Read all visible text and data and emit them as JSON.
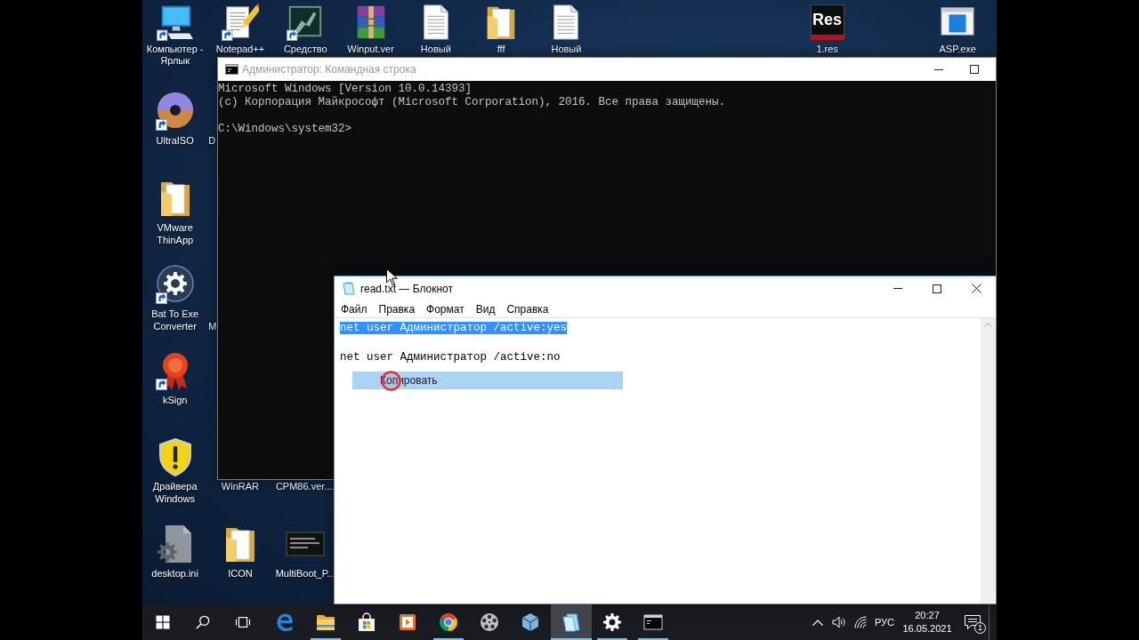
{
  "desktop": {
    "icons": [
      {
        "label": "Компьютер - Ярлык",
        "kind": "computer",
        "shortcut": true
      },
      {
        "label": "Notepad++",
        "kind": "notepad",
        "shortcut": true
      },
      {
        "label": "Средство",
        "kind": "picture",
        "shortcut": true
      },
      {
        "label": "Winput.ver",
        "kind": "archive",
        "shortcut": false
      },
      {
        "label": "Новый",
        "kind": "document",
        "shortcut": false
      },
      {
        "label": "fff",
        "kind": "folder",
        "shortcut": false
      },
      {
        "label": "Новый",
        "kind": "document",
        "shortcut": false
      },
      {
        "label": "1.res",
        "kind": "logo",
        "logo_text": "Res"
      },
      {
        "label": "ASP.exe",
        "kind": "window",
        "shortcut": false
      },
      {
        "label": "UltraISO",
        "kind": "disc",
        "shortcut": true
      },
      {
        "label": "D",
        "kind": "clipped"
      },
      {
        "label": "VMware ThinApp",
        "kind": "folder",
        "shortcut": false
      },
      {
        "label": "Bat To Exe Converter",
        "kind": "gear",
        "shortcut": true
      },
      {
        "label": "M",
        "kind": "clipped"
      },
      {
        "label": "kSign",
        "kind": "rosette",
        "shortcut": true
      },
      {
        "label": "Драйвера Windows",
        "kind": "shield",
        "shortcut": false
      },
      {
        "label": "WinRAR",
        "kind": "covered"
      },
      {
        "label": "CPM86.ver....",
        "kind": "covered"
      },
      {
        "label": "desktop.ini",
        "kind": "gearfile",
        "shortcut": false
      },
      {
        "label": "ICON",
        "kind": "folder",
        "shortcut": false
      },
      {
        "label": "MultiBoot_P...",
        "kind": "terminal",
        "shortcut": false
      }
    ]
  },
  "cmd_window": {
    "title": "Администратор: Командная строка",
    "active": false,
    "output": [
      "Microsoft Windows [Version 10.0.14393]",
      "(c) Корпорация Майкрософт (Microsoft Corporation), 2016. Все права защищены."
    ],
    "prompt": "C:\\Windows\\system32>"
  },
  "notepad_window": {
    "title": "read.txt — Блокнот",
    "active": true,
    "menu": [
      "Файл",
      "Правка",
      "Формат",
      "Вид",
      "Справка"
    ],
    "lines": [
      {
        "text": "net user Администратор /active:yes",
        "selected": true
      },
      {
        "text": "net user Администратор /active:no",
        "selected": false
      }
    ],
    "context_menu": {
      "items": [
        {
          "label": "Копировать",
          "selected": true
        }
      ]
    }
  },
  "taskbar": {
    "system_buttons": [
      {
        "kind": "start"
      },
      {
        "kind": "search"
      },
      {
        "kind": "taskview"
      }
    ],
    "apps": [
      {
        "kind": "letter-e",
        "running": false,
        "active": false
      },
      {
        "kind": "folder",
        "running": true,
        "active": false
      },
      {
        "kind": "store",
        "running": false,
        "active": false
      },
      {
        "kind": "play",
        "running": false,
        "active": false
      },
      {
        "kind": "ball",
        "running": true,
        "active": false
      },
      {
        "kind": "reel",
        "running": false,
        "active": false
      },
      {
        "kind": "cube",
        "running": false,
        "active": false
      },
      {
        "kind": "notepad",
        "running": true,
        "active": true
      },
      {
        "kind": "gear",
        "running": true,
        "active": false
      },
      {
        "kind": "terminal",
        "running": true,
        "active": false
      }
    ],
    "tray": {
      "language": "РУС",
      "time": "20:27",
      "date": "16.05.2021",
      "notifications": "1"
    }
  }
}
